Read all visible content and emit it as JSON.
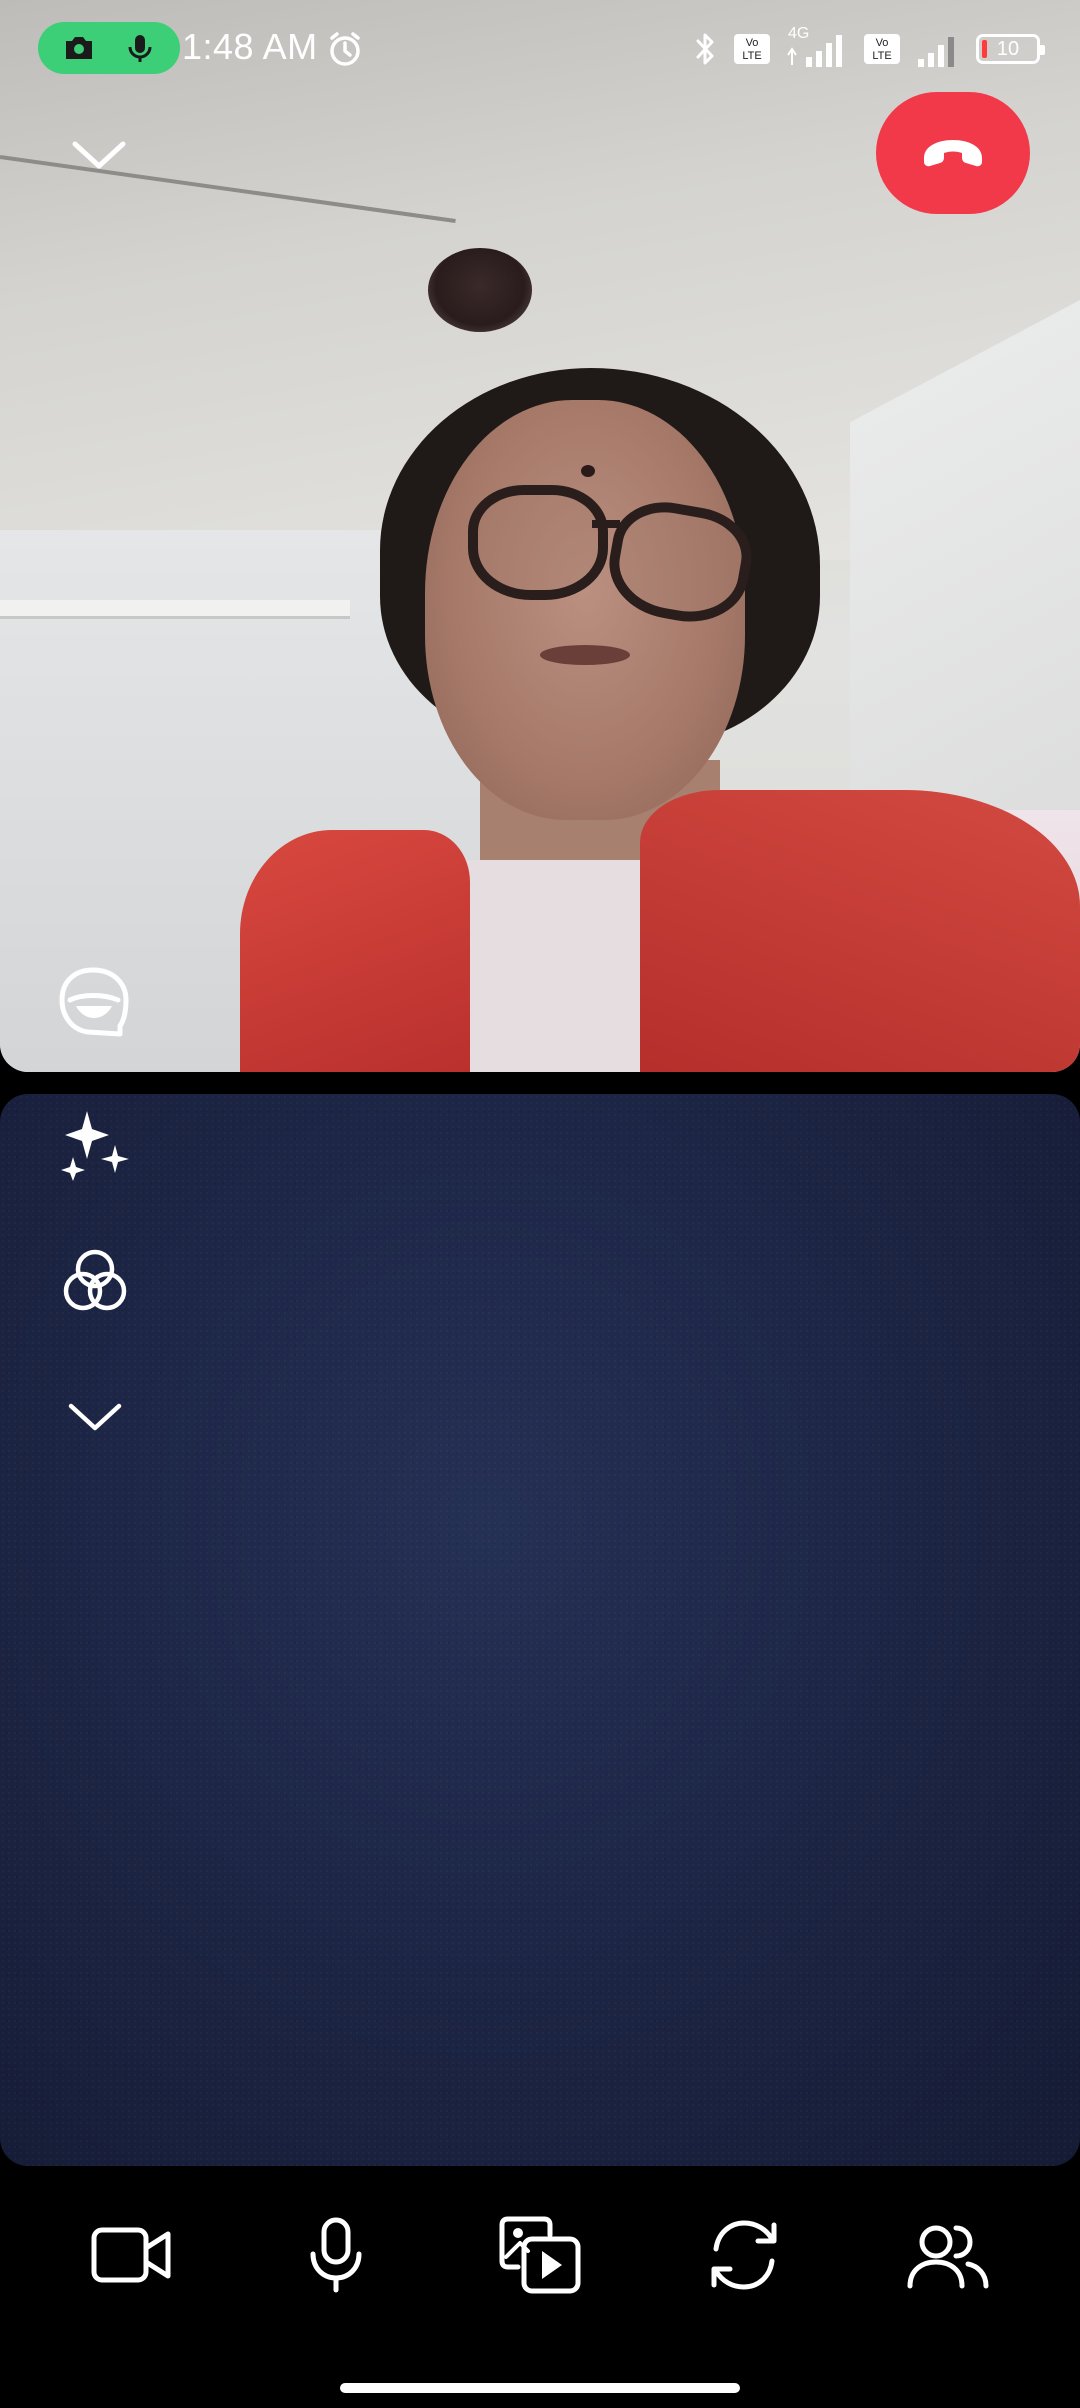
{
  "status_bar": {
    "time": "1:48 AM",
    "network_label": "4G",
    "volte_label": "Vo LTE",
    "battery_level": "10",
    "icons": [
      "camera-in-use-icon",
      "mic-in-use-icon",
      "alarm-icon",
      "bluetooth-icon",
      "volte-icon",
      "signal-icon",
      "battery-icon"
    ]
  },
  "call": {
    "remote_video_label": "",
    "end_call_color": "#f2394a",
    "privacy_indicator_color": "#3ccf78"
  },
  "side_tools": [
    "lenses-sparkle-icon",
    "filters-icon",
    "chevron-down-icon"
  ],
  "controls": [
    {
      "name": "video-toggle-button",
      "icon": "video-camera-icon"
    },
    {
      "name": "mic-toggle-button",
      "icon": "microphone-icon"
    },
    {
      "name": "share-media-button",
      "icon": "media-share-icon"
    },
    {
      "name": "flip-camera-button",
      "icon": "flip-camera-icon"
    },
    {
      "name": "participants-button",
      "icon": "participants-icon"
    }
  ]
}
